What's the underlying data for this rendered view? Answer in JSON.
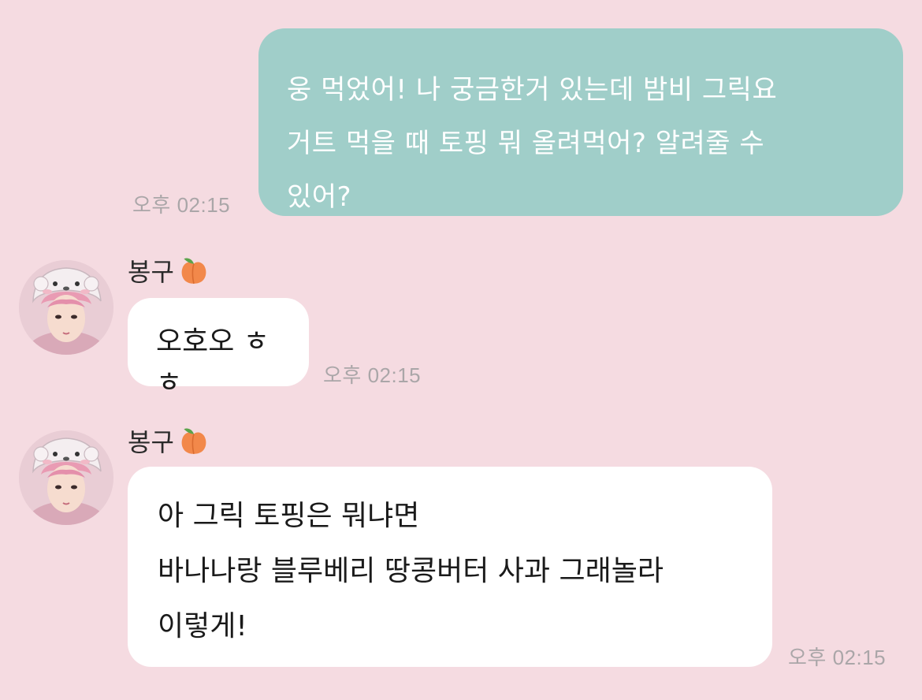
{
  "messages": {
    "outgoing": {
      "text": "웅 먹었어! 나 궁금한거 있는데 밤비 그릭요\n거트 먹을 때 토핑 뭐 올려먹어? 알려줄 수\n있어?",
      "time": "오후 02:15"
    },
    "incoming": [
      {
        "sender": "봉구",
        "sender_emoji": "peach-icon",
        "text": "오호오 ㅎㅎ",
        "time": "오후 02:15"
      },
      {
        "sender": "봉구",
        "sender_emoji": "peach-icon",
        "text": "아 그릭 토핑은 뭐냐면\n바나나랑 블루베리 땅콩버터 사과 그래놀라\n이렇게!",
        "time": "오후 02:15"
      }
    ]
  },
  "colors": {
    "background": "#f5dbe1",
    "outgoing_bubble": "#a0cec9",
    "incoming_bubble": "#ffffff",
    "timestamp": "#aaa6a8"
  }
}
